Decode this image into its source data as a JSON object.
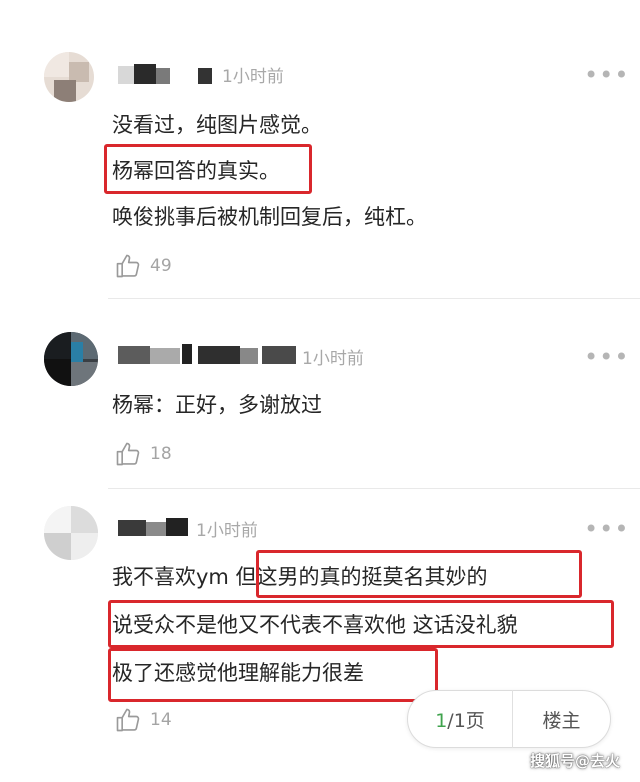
{
  "comments": [
    {
      "time": "1小时前",
      "lines": [
        "没看过，纯图片感觉。",
        "杨幂回答的真实。",
        "唤俊挑事后被机制回复后，纯杠。"
      ],
      "likes": "49"
    },
    {
      "time": "1小时前",
      "lines": [
        "杨幂：正好，多谢放过"
      ],
      "likes": "18"
    },
    {
      "time": "1小时前",
      "lines": [
        "我不喜欢ym 但这男的真的挺莫名其妙的",
        "说受众不是他又不代表不喜欢他 这话没礼貌",
        "极了还感觉他理解能力很差"
      ],
      "likes": "14"
    }
  ],
  "more_glyph": "•••",
  "pager": {
    "current": "1",
    "total": "/1页",
    "op_label": "楼主"
  },
  "watermark": "搜狐号@去火",
  "colors": {
    "highlight_box": "#d9272c",
    "pager_current": "#3fa34d"
  },
  "icons": [
    "thumbs-up-icon",
    "more-dots-icon"
  ]
}
